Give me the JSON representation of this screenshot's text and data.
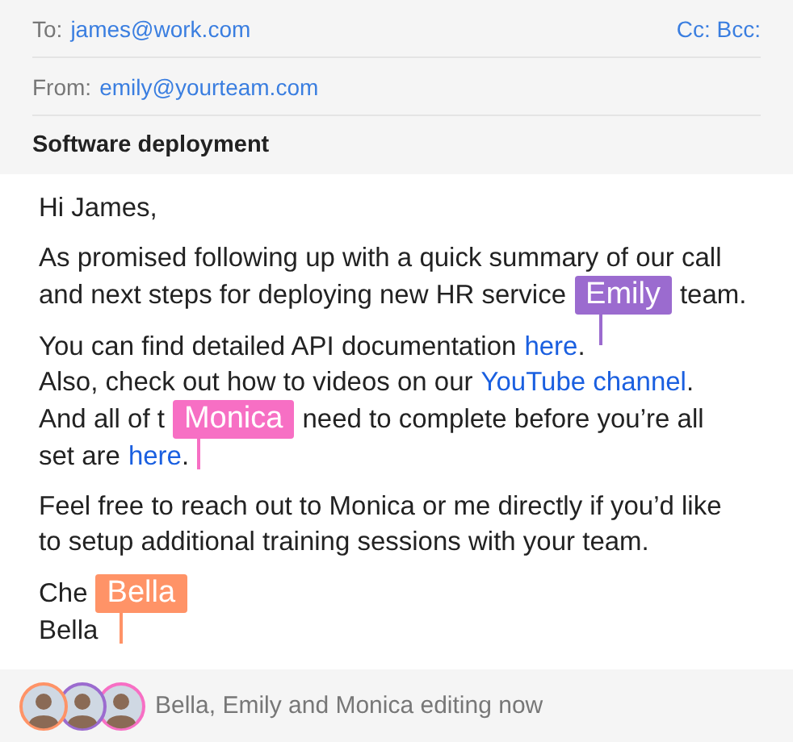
{
  "header": {
    "to_label": "To:",
    "to": "james@work.com",
    "cc_bcc": "Cc: Bcc:",
    "from_label": "From:",
    "from": "emily@yourteam.com",
    "subject": "Software deployment"
  },
  "body": [
    {
      "lines": [
        [
          {
            "kind": "text",
            "text": "Hi James,"
          }
        ]
      ]
    },
    {
      "lines": [
        [
          {
            "kind": "text",
            "text": "As promised following up with a quick summary of our call"
          }
        ],
        [
          {
            "kind": "text",
            "text": "and next steps for deploying new HR service"
          },
          {
            "kind": "tag",
            "text": "Emily",
            "color": "#9b6bcf"
          },
          {
            "kind": "text",
            "text": "team."
          }
        ]
      ]
    },
    {
      "lines": [
        [
          {
            "kind": "text",
            "text": "You can find detailed API documentation"
          },
          {
            "kind": "link",
            "text": "here"
          },
          {
            "kind": "text",
            "text": "."
          }
        ],
        [
          {
            "kind": "text",
            "text": "Also, check out how to videos on our"
          },
          {
            "kind": "link",
            "text": "YouTube channel"
          },
          {
            "kind": "text",
            "text": "."
          }
        ],
        [
          {
            "kind": "text",
            "text": "And all of t"
          },
          {
            "kind": "tag",
            "text": "Monica",
            "color": "#f76fc4"
          },
          {
            "kind": "text",
            "text": "need to complete before you’re all"
          }
        ],
        [
          {
            "kind": "text",
            "text": "set are"
          },
          {
            "kind": "link",
            "text": "here"
          },
          {
            "kind": "text",
            "text": "."
          }
        ]
      ]
    },
    {
      "lines": [
        [
          {
            "kind": "text",
            "text": "Feel free to reach out to Monica or me directly if you’d like"
          }
        ],
        [
          {
            "kind": "text",
            "text": "to setup additional training sessions with your team."
          }
        ]
      ]
    },
    {
      "lines": [
        [
          {
            "kind": "text",
            "text": "Che"
          },
          {
            "kind": "tag",
            "text": "Bella",
            "color": "#ff9367"
          }
        ],
        [
          {
            "kind": "text",
            "text": "Bella"
          }
        ]
      ]
    }
  ],
  "footer": {
    "avatars": [
      {
        "color": "#ff9367"
      },
      {
        "color": "#9b6bcf"
      },
      {
        "color": "#f76fc4"
      }
    ],
    "status": "Bella, Emily and Monica editing now"
  }
}
